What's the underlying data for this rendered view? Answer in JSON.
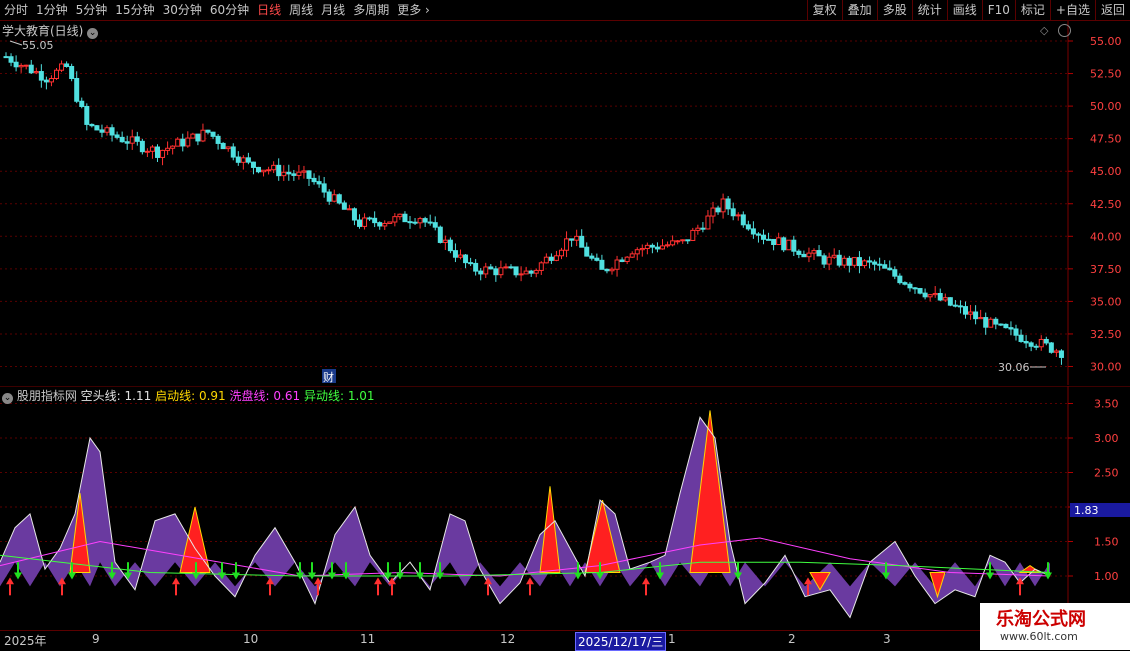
{
  "toolbar": {
    "periods": [
      "分时",
      "1分钟",
      "5分钟",
      "15分钟",
      "30分钟",
      "60分钟",
      "日线",
      "周线",
      "月线",
      "多周期",
      "更多"
    ],
    "active_index": 6,
    "right_tools": [
      "复权",
      "叠加",
      "多股",
      "统计",
      "画线",
      "F10",
      "标记",
      "+自选",
      "返回"
    ]
  },
  "main": {
    "title": "学大教育(日线)",
    "high_label": "55.05",
    "low_label": "30.06",
    "fin_marker": "财",
    "y_ticks": [
      "55.00",
      "52.50",
      "50.00",
      "47.50",
      "45.00",
      "42.50",
      "40.00",
      "37.50",
      "35.00",
      "32.50",
      "30.00"
    ]
  },
  "indicator": {
    "name": "股朋指标网",
    "line1_label": "空头线:",
    "line1_value": "1.11",
    "line2_label": "启动线:",
    "line2_value": "0.91",
    "line3_label": "洗盘线:",
    "line3_value": "0.61",
    "line4_label": "异动线:",
    "line4_value": "1.01",
    "y_ticks": [
      "3.50",
      "3.00",
      "2.50",
      "2.00",
      "1.50",
      "1.00"
    ],
    "cursor_value": "1.83"
  },
  "date_axis": {
    "labels": [
      "2025年",
      "9",
      "10",
      "11",
      "12",
      "1",
      "2",
      "3"
    ],
    "cursor_date": "2025/12/17/三"
  },
  "watermark": {
    "title": "乐淘公式网",
    "url": "www.60lt.com"
  },
  "colors": {
    "up": "#ff3030",
    "down": "#50e0e0",
    "purple": "#6a3aa0",
    "grid": "#7a0000"
  },
  "chart_data": {
    "type": "candlestick",
    "close_start": 55.05,
    "close_end": 30.06,
    "y_range": [
      30.0,
      55.0
    ]
  }
}
